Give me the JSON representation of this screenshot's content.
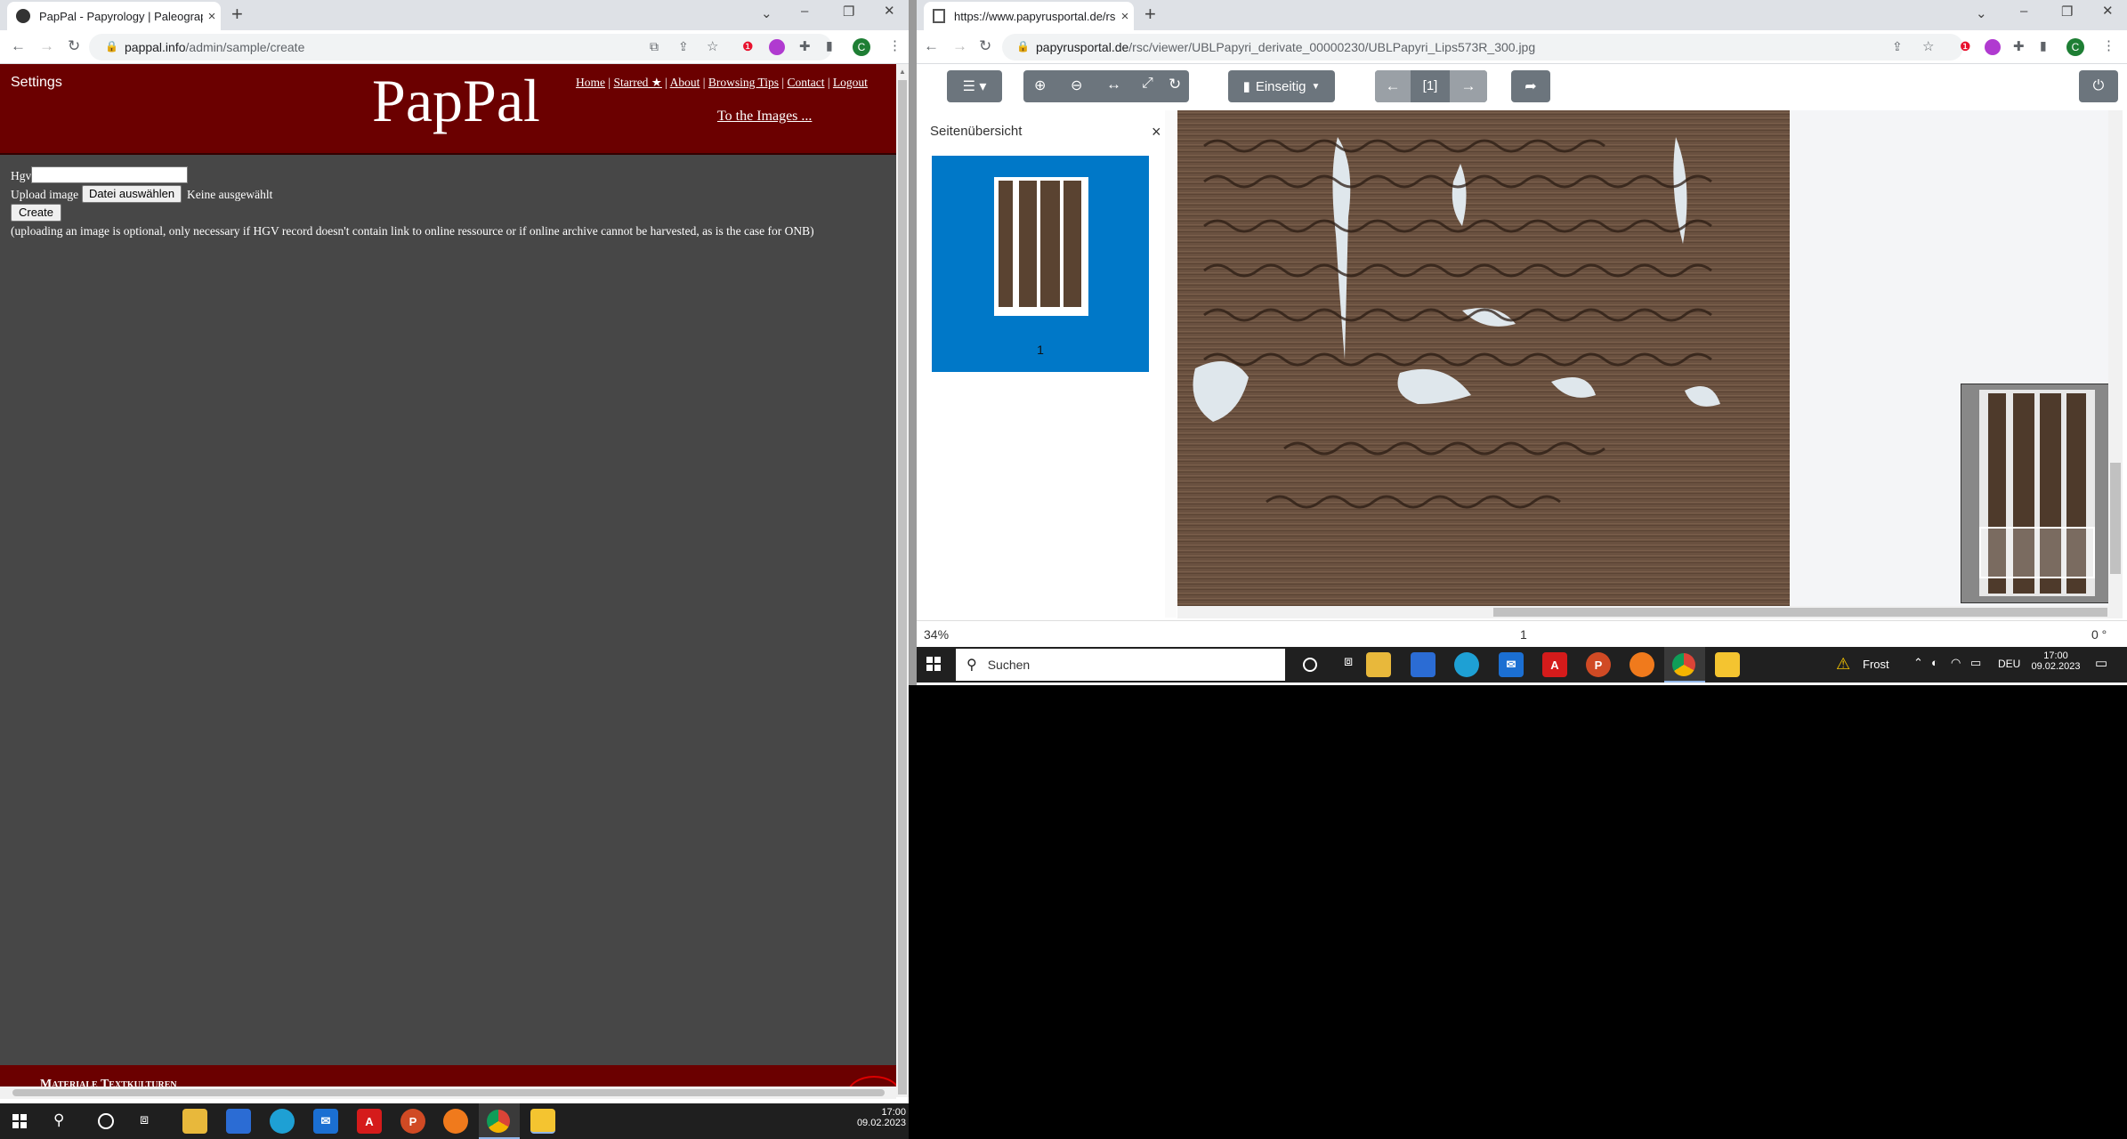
{
  "left_browser": {
    "tab_title": "PapPal - Papyrology | Paleograph",
    "url_host": "pappal.info",
    "url_path": "/admin/sample/create",
    "profile_initial": "C"
  },
  "pappal": {
    "settings": "Settings",
    "logo": "PapPal",
    "nav": [
      "Home",
      "Starred ★",
      "About",
      "Browsing Tips",
      "Contact",
      "Logout"
    ],
    "to_images": "To the Images ...",
    "hgv_label": "Hgv",
    "upload_label": "Upload image",
    "file_button": "Datei auswählen",
    "no_file": "Keine ausgewählt",
    "create_button": "Create",
    "note": "(uploading an image is optional, only necessary if HGV record doesn't contain link to online ressource or if online archive cannot be harvested, as is the case for ONB)",
    "footer_text": "Materiale Textkulturen"
  },
  "right_browser": {
    "tab_title": "https://www.papyrusportal.de/rsc",
    "url_host": "papyrusportal.de",
    "url_path": "/rsc/viewer/UBLPapyri_derivate_00000230/UBLPapyri_Lips573R_300.jpg",
    "profile_initial": "C"
  },
  "viewer": {
    "mode_label": "Einseitig",
    "page_indicator": "[1]",
    "sidebar_title": "Seitenübersicht",
    "thumb_page": "1",
    "zoom": "34%",
    "page": "1",
    "rotation": "0 °"
  },
  "taskbar_right": {
    "search_placeholder": "Suchen",
    "weather": "Frost",
    "lang": "DEU",
    "time": "17:00",
    "date": "09.02.2023"
  },
  "taskbar_left": {
    "time": "17:00",
    "date": "09.02.2023"
  },
  "colors": {
    "pappal_header": "#6b0000",
    "pappal_body": "#474747",
    "viewer_thumb_bg": "#0078c8",
    "viewer_button": "#6c757d"
  }
}
